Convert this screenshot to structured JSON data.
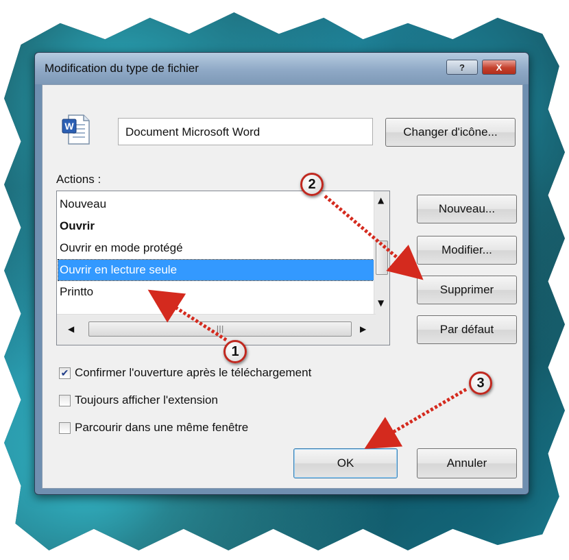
{
  "dialog": {
    "title": "Modification du type de fichier",
    "help_label": "?",
    "close_label": "X"
  },
  "file_type": {
    "icon": "word-document-icon",
    "name_value": "Document Microsoft Word",
    "change_icon_label": "Changer d'icône..."
  },
  "actions": {
    "label": "Actions :",
    "items": [
      {
        "label": "Nouveau",
        "bold": false,
        "selected": false
      },
      {
        "label": "Ouvrir",
        "bold": true,
        "selected": false
      },
      {
        "label": "Ouvrir en mode protégé",
        "bold": false,
        "selected": false
      },
      {
        "label": "Ouvrir en lecture seule",
        "bold": false,
        "selected": true
      },
      {
        "label": "Printto",
        "bold": false,
        "selected": false
      }
    ],
    "new_label": "Nouveau...",
    "edit_label": "Modifier...",
    "delete_label": "Supprimer",
    "default_label": "Par défaut"
  },
  "options": {
    "confirm_open": {
      "label": "Confirmer l'ouverture après le téléchargement",
      "checked": true
    },
    "always_show_ext": {
      "label": "Toujours afficher l'extension",
      "checked": false
    },
    "browse_same_window": {
      "label": "Parcourir dans une même fenêtre",
      "checked": false
    }
  },
  "footer": {
    "ok_label": "OK",
    "cancel_label": "Annuler"
  },
  "callouts": [
    "1",
    "2",
    "3"
  ],
  "colors": {
    "selection": "#3399ff",
    "callout_border": "#c0281f",
    "arrow": "#d42a1e"
  }
}
